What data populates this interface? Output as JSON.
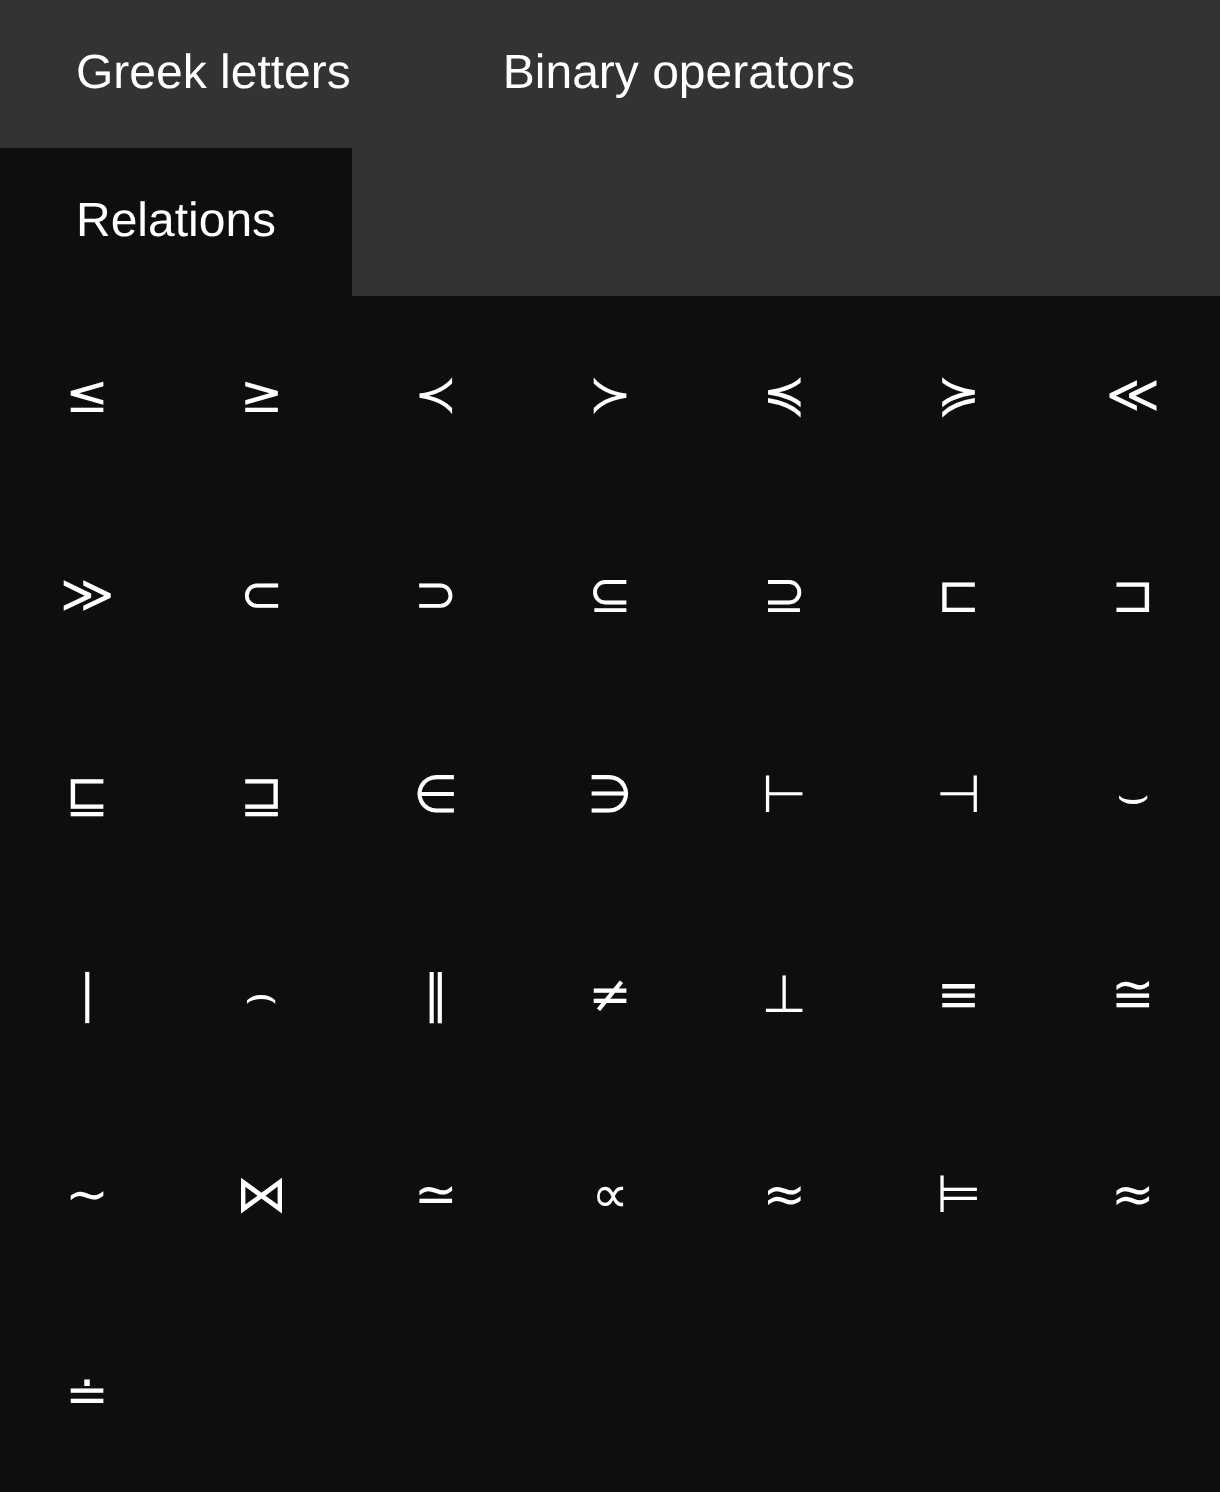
{
  "tabs": [
    {
      "label": "Greek letters",
      "selected": false
    },
    {
      "label": "Binary operators",
      "selected": false
    },
    {
      "label": "Relations",
      "selected": true
    }
  ],
  "symbols": [
    "≤",
    "≥",
    "≺",
    "≻",
    "≼",
    "≽",
    "≪",
    "≫",
    "⊂",
    "⊃",
    "⊆",
    "⊇",
    "⊏",
    "⊐",
    "⊑",
    "⊒",
    "∈",
    "∋",
    "⊢",
    "⊣",
    "⌣",
    "∣",
    "⌢",
    "∥",
    "≠",
    "⊥",
    "≡",
    "≅",
    "∼",
    "⋈",
    "≃",
    "∝",
    "≈",
    "⊨",
    "≈",
    "≐"
  ]
}
